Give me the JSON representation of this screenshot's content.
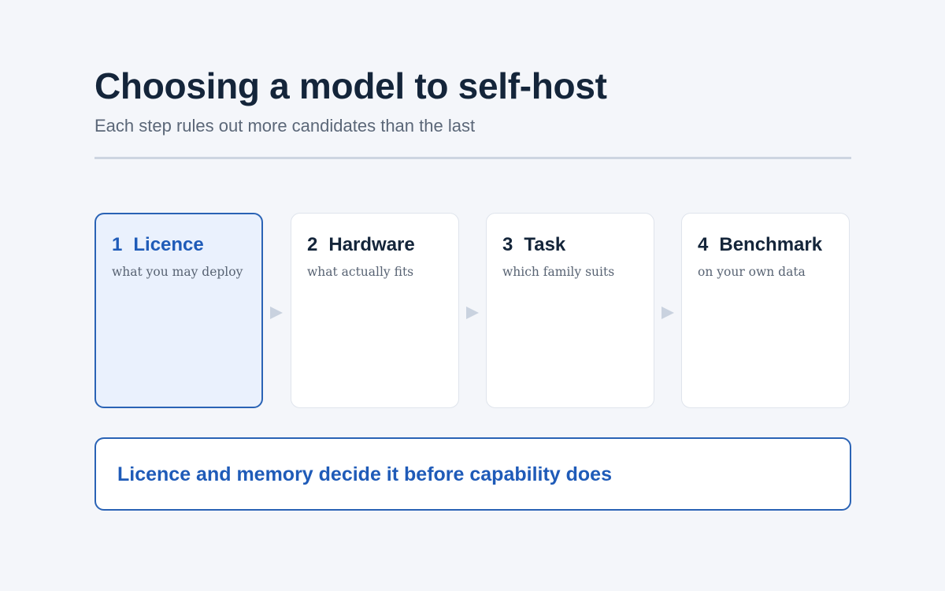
{
  "header": {
    "title": "Choosing a model to self-host",
    "subtitle": "Each step rules out more candidates than the last"
  },
  "steps": [
    {
      "number": "1",
      "label": "Licence",
      "description": "what you may deploy",
      "active": true
    },
    {
      "number": "2",
      "label": "Hardware",
      "description": "what actually fits",
      "active": false
    },
    {
      "number": "3",
      "label": "Task",
      "description": "which family suits",
      "active": false
    },
    {
      "number": "4",
      "label": "Benchmark",
      "description": "on your own data",
      "active": false
    }
  ],
  "callout": {
    "text": "Licence and memory decide it before capability does"
  },
  "colors": {
    "accent": "#1f5bb8",
    "active_fill": "#eaf1fd",
    "title": "#14253a",
    "arrow": "#c9d2df"
  }
}
